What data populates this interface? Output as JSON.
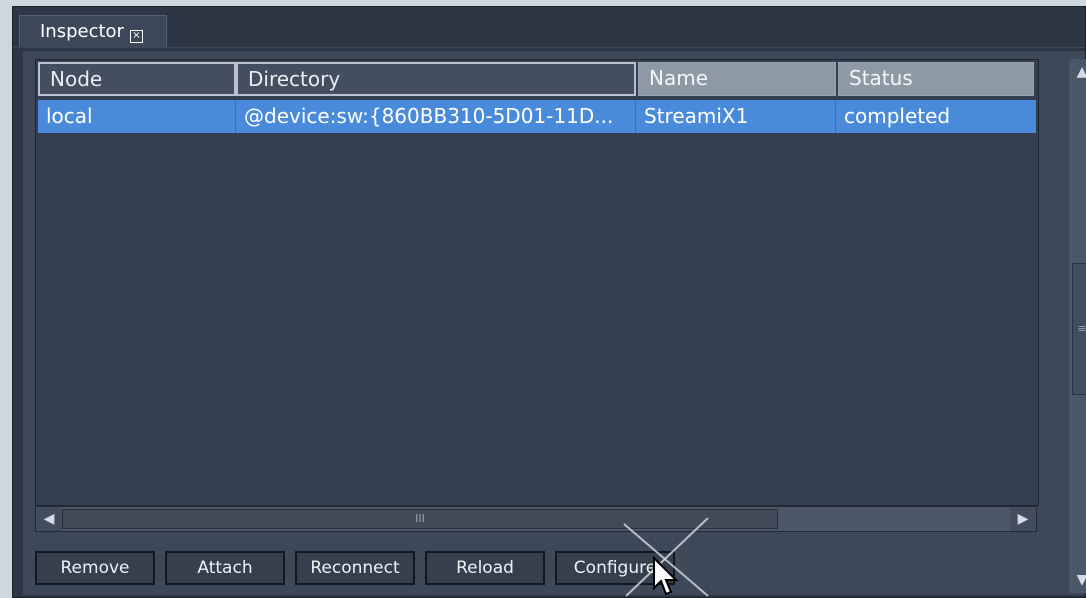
{
  "tab": {
    "title": "Inspector",
    "close_glyph": "×"
  },
  "columns": [
    "Node",
    "Directory",
    "Name",
    "Status"
  ],
  "rows": [
    {
      "node": "local",
      "directory": "@device:sw:{860BB310-5D01-11D...",
      "name": "StreamiX1",
      "status": "completed"
    }
  ],
  "scroll": {
    "thumb_grip": "III",
    "left_arrow": "◀",
    "right_arrow": "▶",
    "up_arrow": "▲",
    "down_arrow": "▼",
    "v_thumb_grip": "≡"
  },
  "buttons": {
    "remove": "Remove",
    "attach": "Attach",
    "reconnect": "Reconnect",
    "reload": "Reload",
    "configure": "Configure"
  },
  "colors": {
    "panel": "#3d4859",
    "selection": "#4a8adb",
    "header_gray": "#8e99a6"
  }
}
